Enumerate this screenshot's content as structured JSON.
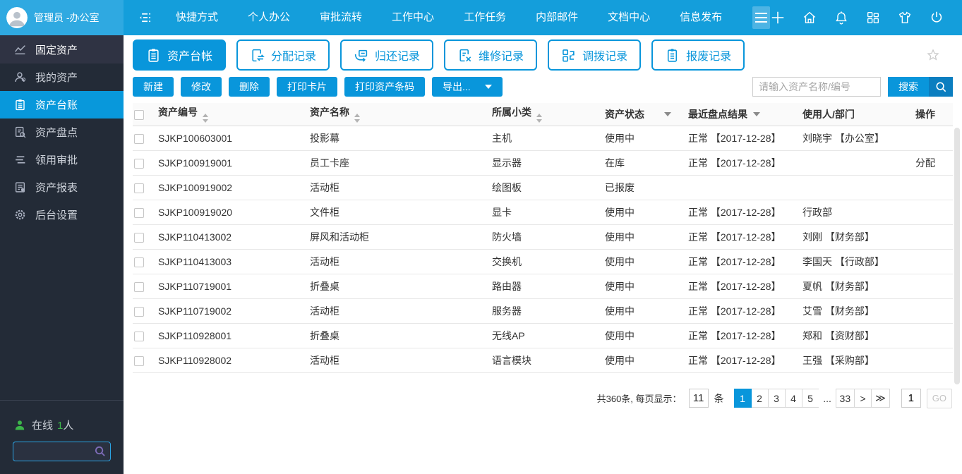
{
  "colors": {
    "accent_blue": "#0996db",
    "topbar_blue": "#149edb",
    "topbar_user_block": "#2fa9e1",
    "sidebar_bg": "#232b37",
    "sidebar_header_bg": "#2f3343",
    "sidebar_active_bg": "#0898db",
    "online_green": "#3cb54a",
    "search_dark_blue": "#0b7ec0",
    "sidebar_search_border": "#2aa3e3",
    "sidebar_search_magnifier": "#7e6cb8"
  },
  "topbar": {
    "user": "管理员 -办公室",
    "nav_items": [
      "快捷方式",
      "个人办公",
      "审批流转",
      "工作中心",
      "工作任务",
      "内部邮件",
      "文档中心",
      "信息发布"
    ],
    "right_icons": [
      "plus",
      "home",
      "bell",
      "grid",
      "shirt",
      "power"
    ]
  },
  "sidebar": {
    "items": [
      {
        "label": "固定资产",
        "icon": "chart",
        "type": "header",
        "active": false
      },
      {
        "label": "我的资产",
        "icon": "user",
        "type": "normal",
        "active": false
      },
      {
        "label": "资产台账",
        "icon": "clipboard",
        "type": "normal",
        "active": true
      },
      {
        "label": "资产盘点",
        "icon": "doc-search",
        "type": "normal",
        "active": false
      },
      {
        "label": "领用审批",
        "icon": "layers",
        "type": "normal",
        "active": false
      },
      {
        "label": "资产报表",
        "icon": "report",
        "type": "normal",
        "active": false
      },
      {
        "label": "后台设置",
        "icon": "gear",
        "type": "normal",
        "active": false
      }
    ],
    "online_label": "在线",
    "online_count": "1",
    "online_suffix": "人",
    "search_value": ""
  },
  "tabs": [
    {
      "label": "资产台帐",
      "icon": "tab-ledger",
      "active": true
    },
    {
      "label": "分配记录",
      "icon": "tab-assign",
      "active": false
    },
    {
      "label": "归还记录",
      "icon": "tab-return",
      "active": false
    },
    {
      "label": "维修记录",
      "icon": "tab-repair",
      "active": false
    },
    {
      "label": "调拨记录",
      "icon": "tab-transfer",
      "active": false
    },
    {
      "label": "报废记录",
      "icon": "tab-scrap",
      "active": false
    }
  ],
  "toolbar": {
    "buttons": [
      "新建",
      "修改",
      "删除",
      "打印卡片",
      "打印资产条码"
    ],
    "export_label": "导出...",
    "search_placeholder": "请输入资产名称/编号",
    "search_button": "搜索"
  },
  "table": {
    "columns": [
      "资产编号",
      "资产名称",
      "所属小类",
      "资产状态",
      "最近盘点结果",
      "使用人/部门",
      "操作"
    ],
    "rows": [
      {
        "id": "SJKP100603001",
        "name": "投影幕",
        "category": "主机",
        "status": "使用中",
        "check": "正常 【2017-12-28】",
        "user": "刘晓宇 【办公室】",
        "action": ""
      },
      {
        "id": "SJKP100919001",
        "name": "员工卡座",
        "category": "显示器",
        "status": "在库",
        "check": "正常 【2017-12-28】",
        "user": "",
        "action": "分配"
      },
      {
        "id": "SJKP100919002",
        "name": "活动柜",
        "category": "绘图板",
        "status": "已报废",
        "check": "",
        "user": "",
        "action": ""
      },
      {
        "id": "SJKP100919020",
        "name": "文件柜",
        "category": "显卡",
        "status": "使用中",
        "check": "正常 【2017-12-28】",
        "user": "行政部",
        "action": ""
      },
      {
        "id": "SJKP110413002",
        "name": "屏风和活动柜",
        "category": "防火墙",
        "status": "使用中",
        "check": "正常 【2017-12-28】",
        "user": "刘刚 【财务部】",
        "action": ""
      },
      {
        "id": "SJKP110413003",
        "name": "活动柜",
        "category": "交换机",
        "status": "使用中",
        "check": "正常 【2017-12-28】",
        "user": "李国天 【行政部】",
        "action": ""
      },
      {
        "id": "SJKP110719001",
        "name": "折叠桌",
        "category": "路由器",
        "status": "使用中",
        "check": "正常 【2017-12-28】",
        "user": "夏帆 【财务部】",
        "action": ""
      },
      {
        "id": "SJKP110719002",
        "name": "活动柜",
        "category": "服务器",
        "status": "使用中",
        "check": "正常 【2017-12-28】",
        "user": "艾雪 【财务部】",
        "action": ""
      },
      {
        "id": "SJKP110928001",
        "name": "折叠桌",
        "category": "无线AP",
        "status": "使用中",
        "check": "正常 【2017-12-28】",
        "user": "郑和 【资财部】",
        "action": ""
      },
      {
        "id": "SJKP110928002",
        "name": "活动柜",
        "category": "语言模块",
        "status": "使用中",
        "check": "正常 【2017-12-28】",
        "user": "王强 【采购部】",
        "action": ""
      }
    ]
  },
  "pagination": {
    "total_text": "共360条, 每页显示：",
    "page_size": "11",
    "unit": "条",
    "pages": [
      "1",
      "2",
      "3",
      "4",
      "5",
      "...",
      "33",
      ">",
      "≫"
    ],
    "active_page": "1",
    "goto_value": "1",
    "go_label": "GO"
  }
}
